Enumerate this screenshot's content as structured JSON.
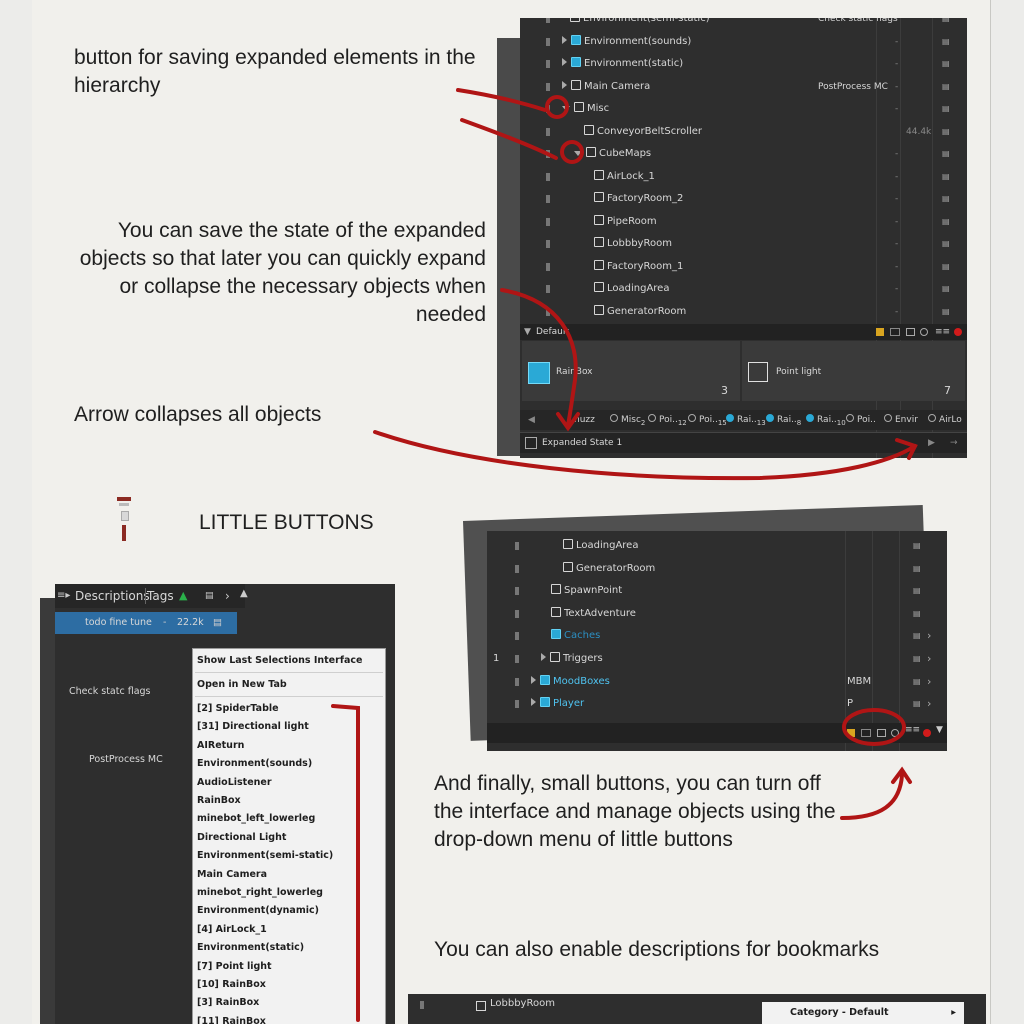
{
  "notes": {
    "save_button": "button for saving expanded elements in the hierarchy",
    "save_state": "You can save the state of the expanded objects so that later you can quickly expand or collapse the necessary objects when needed",
    "arrow": "Arrow collapses all objects",
    "little_buttons": "LITTLE BUTTONS",
    "finally": "And finally, small buttons, you can turn off the interface and manage objects using the drop-down menu of little buttons",
    "descriptions": "You can also enable descriptions for bookmarks"
  },
  "hierarchy_top": {
    "rows": [
      {
        "label": "Environment(semi-static)",
        "col": "Check static flags",
        "dash": ""
      },
      {
        "label": "Environment(sounds)",
        "col": "",
        "dash": "-"
      },
      {
        "label": "Environment(static)",
        "col": "",
        "dash": "-"
      },
      {
        "label": "Main Camera",
        "col": "PostProcess MC",
        "dash": "-"
      },
      {
        "label": "Misc",
        "col": "",
        "dash": "-"
      },
      {
        "label": "ConveyorBeltScroller",
        "col": "",
        "dash": "44.4k"
      },
      {
        "label": "CubeMaps",
        "col": "",
        "dash": "-"
      },
      {
        "label": "AirLock_1",
        "col": "",
        "dash": "-"
      },
      {
        "label": "FactoryRoom_2",
        "col": "",
        "dash": "-"
      },
      {
        "label": "PipeRoom",
        "col": "",
        "dash": "-"
      },
      {
        "label": "LobbbyRoom",
        "col": "",
        "dash": "-"
      },
      {
        "label": "FactoryRoom_1",
        "col": "",
        "dash": "-"
      },
      {
        "label": "LoadingArea",
        "col": "",
        "dash": "-"
      },
      {
        "label": "GeneratorRoom",
        "col": "",
        "dash": "-"
      }
    ],
    "default_label": "Default",
    "card1": {
      "label": "RainBox",
      "count": "3"
    },
    "card2": {
      "label": "Point light",
      "count": "7"
    },
    "tabs": [
      "nuzz",
      "Misc",
      "Poi..",
      "Poi..",
      "Rai..",
      "Rai..",
      "Rai..",
      "Poi..",
      "Envir",
      "AirLo"
    ],
    "tab_nums": [
      "",
      "2",
      "12",
      "15",
      "13",
      "8",
      "10",
      "",
      "",
      ""
    ],
    "expanded_state": "Expanded State 1"
  },
  "left_panel": {
    "header_descriptions": "Descriptions",
    "header_tags": "Tags",
    "selected_row": "todo fine tune",
    "selected_value": "22.2k",
    "col_check": "Check statc flags",
    "col_pp": "PostProcess  MC"
  },
  "context_menu": {
    "top": [
      "Show Last Selections Interface",
      "Open in New Tab"
    ],
    "items": [
      "[2]   SpiderTable",
      "[31]   Directional light",
      "AIReturn",
      "Environment(sounds)",
      "AudioListener",
      "RainBox",
      "minebot_left_lowerleg",
      "Directional Light",
      "Environment(semi-static)",
      "Main Camera",
      "minebot_right_lowerleg",
      "Environment(dynamic)",
      "[4]   AirLock_1",
      "Environment(static)",
      "[7]   Point light",
      "[10]   RainBox",
      "[3]   RainBox",
      "[11]   RainBox"
    ]
  },
  "hierarchy_mid": {
    "rows": [
      {
        "label": "LoadingArea",
        "col": "",
        "blue": false
      },
      {
        "label": "GeneratorRoom",
        "col": "",
        "blue": false
      },
      {
        "label": "SpawnPoint",
        "col": "",
        "blue": false
      },
      {
        "label": "TextAdventure",
        "col": "",
        "blue": false
      },
      {
        "label": "Caches",
        "col": "",
        "blue": true
      },
      {
        "label": "Triggers",
        "col": "",
        "blue": false
      },
      {
        "label": "MoodBoxes",
        "col": "MBM",
        "blue": true
      },
      {
        "label": "Player",
        "col": "P",
        "blue": true
      }
    ],
    "row_num": "1"
  },
  "bottom_panel": {
    "row": "LobbbyRoom",
    "category": "Category - Default"
  },
  "colors": {
    "accent_red": "#b01515",
    "panel_bg": "#2e2e2e",
    "selection": "#2d6da3"
  }
}
